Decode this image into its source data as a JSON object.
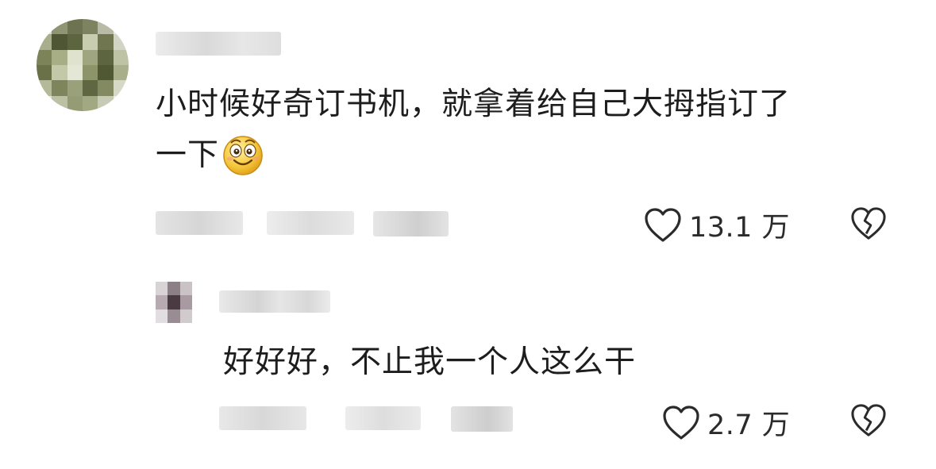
{
  "comments": [
    {
      "text_line1": "小时候好奇订书机，就拿着给自己大拇指订了",
      "text_line2": "一下",
      "emoji": "smile-emoji",
      "likes": "13.1 万"
    }
  ],
  "reply": {
    "text": "好好好，不止我一个人这么干",
    "likes": "2.7 万"
  },
  "icons": {
    "like": "heart-outline-icon",
    "dislike": "broken-heart-icon"
  },
  "colors": {
    "text": "#1d1d1d",
    "icon": "#2b2b2b",
    "blur": "#e6e6e6"
  }
}
